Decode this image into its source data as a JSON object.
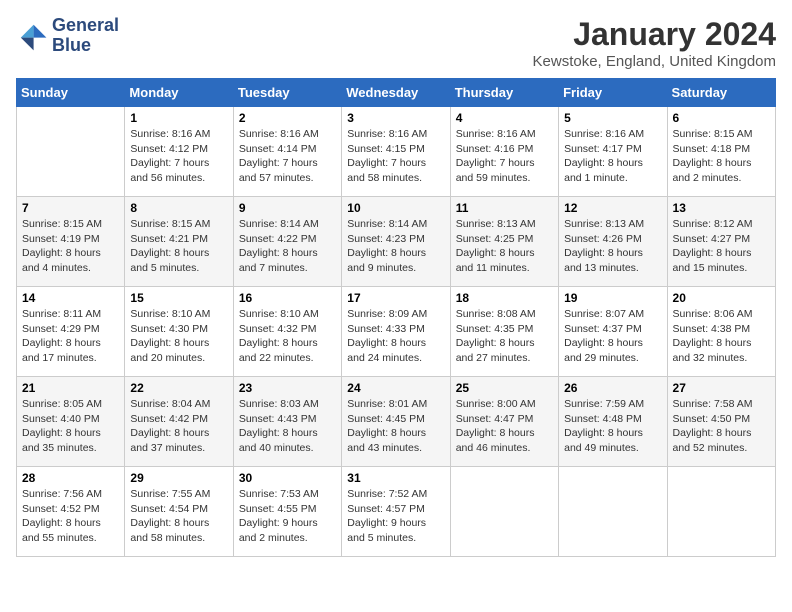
{
  "logo": {
    "line1": "General",
    "line2": "Blue"
  },
  "title": "January 2024",
  "location": "Kewstoke, England, United Kingdom",
  "days_header": [
    "Sunday",
    "Monday",
    "Tuesday",
    "Wednesday",
    "Thursday",
    "Friday",
    "Saturday"
  ],
  "weeks": [
    [
      {
        "num": "",
        "info": ""
      },
      {
        "num": "1",
        "info": "Sunrise: 8:16 AM\nSunset: 4:12 PM\nDaylight: 7 hours\nand 56 minutes."
      },
      {
        "num": "2",
        "info": "Sunrise: 8:16 AM\nSunset: 4:14 PM\nDaylight: 7 hours\nand 57 minutes."
      },
      {
        "num": "3",
        "info": "Sunrise: 8:16 AM\nSunset: 4:15 PM\nDaylight: 7 hours\nand 58 minutes."
      },
      {
        "num": "4",
        "info": "Sunrise: 8:16 AM\nSunset: 4:16 PM\nDaylight: 7 hours\nand 59 minutes."
      },
      {
        "num": "5",
        "info": "Sunrise: 8:16 AM\nSunset: 4:17 PM\nDaylight: 8 hours\nand 1 minute."
      },
      {
        "num": "6",
        "info": "Sunrise: 8:15 AM\nSunset: 4:18 PM\nDaylight: 8 hours\nand 2 minutes."
      }
    ],
    [
      {
        "num": "7",
        "info": "Sunrise: 8:15 AM\nSunset: 4:19 PM\nDaylight: 8 hours\nand 4 minutes."
      },
      {
        "num": "8",
        "info": "Sunrise: 8:15 AM\nSunset: 4:21 PM\nDaylight: 8 hours\nand 5 minutes."
      },
      {
        "num": "9",
        "info": "Sunrise: 8:14 AM\nSunset: 4:22 PM\nDaylight: 8 hours\nand 7 minutes."
      },
      {
        "num": "10",
        "info": "Sunrise: 8:14 AM\nSunset: 4:23 PM\nDaylight: 8 hours\nand 9 minutes."
      },
      {
        "num": "11",
        "info": "Sunrise: 8:13 AM\nSunset: 4:25 PM\nDaylight: 8 hours\nand 11 minutes."
      },
      {
        "num": "12",
        "info": "Sunrise: 8:13 AM\nSunset: 4:26 PM\nDaylight: 8 hours\nand 13 minutes."
      },
      {
        "num": "13",
        "info": "Sunrise: 8:12 AM\nSunset: 4:27 PM\nDaylight: 8 hours\nand 15 minutes."
      }
    ],
    [
      {
        "num": "14",
        "info": "Sunrise: 8:11 AM\nSunset: 4:29 PM\nDaylight: 8 hours\nand 17 minutes."
      },
      {
        "num": "15",
        "info": "Sunrise: 8:10 AM\nSunset: 4:30 PM\nDaylight: 8 hours\nand 20 minutes."
      },
      {
        "num": "16",
        "info": "Sunrise: 8:10 AM\nSunset: 4:32 PM\nDaylight: 8 hours\nand 22 minutes."
      },
      {
        "num": "17",
        "info": "Sunrise: 8:09 AM\nSunset: 4:33 PM\nDaylight: 8 hours\nand 24 minutes."
      },
      {
        "num": "18",
        "info": "Sunrise: 8:08 AM\nSunset: 4:35 PM\nDaylight: 8 hours\nand 27 minutes."
      },
      {
        "num": "19",
        "info": "Sunrise: 8:07 AM\nSunset: 4:37 PM\nDaylight: 8 hours\nand 29 minutes."
      },
      {
        "num": "20",
        "info": "Sunrise: 8:06 AM\nSunset: 4:38 PM\nDaylight: 8 hours\nand 32 minutes."
      }
    ],
    [
      {
        "num": "21",
        "info": "Sunrise: 8:05 AM\nSunset: 4:40 PM\nDaylight: 8 hours\nand 35 minutes."
      },
      {
        "num": "22",
        "info": "Sunrise: 8:04 AM\nSunset: 4:42 PM\nDaylight: 8 hours\nand 37 minutes."
      },
      {
        "num": "23",
        "info": "Sunrise: 8:03 AM\nSunset: 4:43 PM\nDaylight: 8 hours\nand 40 minutes."
      },
      {
        "num": "24",
        "info": "Sunrise: 8:01 AM\nSunset: 4:45 PM\nDaylight: 8 hours\nand 43 minutes."
      },
      {
        "num": "25",
        "info": "Sunrise: 8:00 AM\nSunset: 4:47 PM\nDaylight: 8 hours\nand 46 minutes."
      },
      {
        "num": "26",
        "info": "Sunrise: 7:59 AM\nSunset: 4:48 PM\nDaylight: 8 hours\nand 49 minutes."
      },
      {
        "num": "27",
        "info": "Sunrise: 7:58 AM\nSunset: 4:50 PM\nDaylight: 8 hours\nand 52 minutes."
      }
    ],
    [
      {
        "num": "28",
        "info": "Sunrise: 7:56 AM\nSunset: 4:52 PM\nDaylight: 8 hours\nand 55 minutes."
      },
      {
        "num": "29",
        "info": "Sunrise: 7:55 AM\nSunset: 4:54 PM\nDaylight: 8 hours\nand 58 minutes."
      },
      {
        "num": "30",
        "info": "Sunrise: 7:53 AM\nSunset: 4:55 PM\nDaylight: 9 hours\nand 2 minutes."
      },
      {
        "num": "31",
        "info": "Sunrise: 7:52 AM\nSunset: 4:57 PM\nDaylight: 9 hours\nand 5 minutes."
      },
      {
        "num": "",
        "info": ""
      },
      {
        "num": "",
        "info": ""
      },
      {
        "num": "",
        "info": ""
      }
    ]
  ]
}
